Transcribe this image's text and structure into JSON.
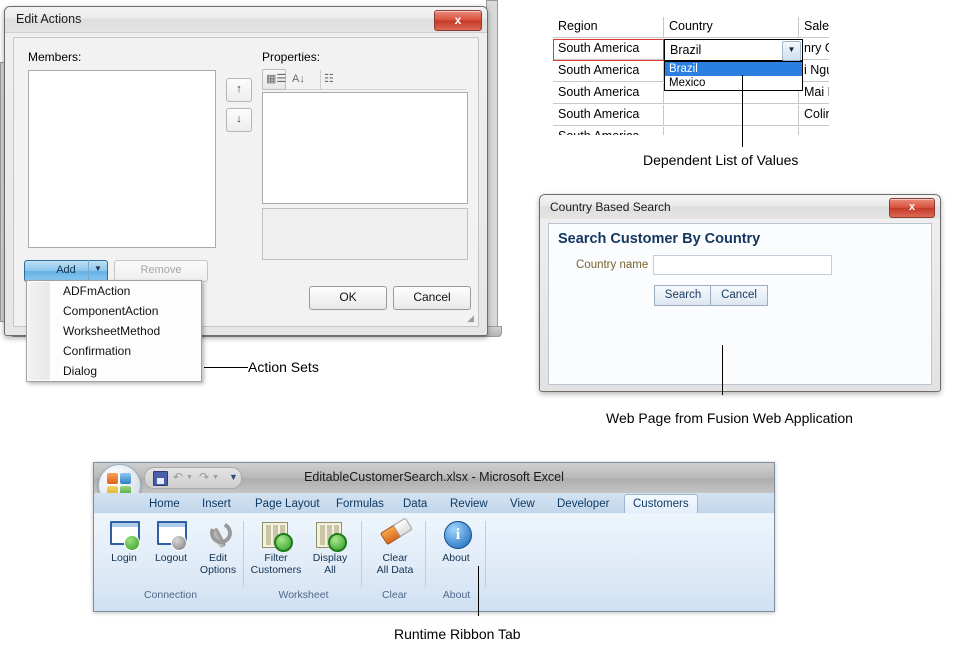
{
  "edit_actions_dialog": {
    "title": "Edit Actions",
    "close_label": "x",
    "members_label": "Members:",
    "properties_label": "Properties:",
    "move_up_label": "↑",
    "move_down_label": "↓",
    "toolbar_icons": [
      "categorized-icon",
      "alphabetical-sort-icon",
      "property-pages-icon"
    ],
    "add_button": "Add",
    "add_dropdown_arrow": "▼",
    "remove_button": "Remove",
    "ok_button": "OK",
    "cancel_button": "Cancel",
    "resize_grip": "◢"
  },
  "action_menu": {
    "items": [
      {
        "label": "ADFmAction"
      },
      {
        "label": "ComponentAction"
      },
      {
        "label": "WorksheetMethod"
      },
      {
        "label": "Confirmation"
      },
      {
        "label": "Dialog"
      }
    ]
  },
  "spreadsheet": {
    "headers": [
      "Region",
      "Country",
      "Sales R"
    ],
    "rows": [
      {
        "region": "South America",
        "country": "Brazil",
        "rep": "nry G"
      },
      {
        "region": "South America",
        "country": "",
        "rep": "i Ngu"
      },
      {
        "region": "South America",
        "country": "",
        "rep": "Mai Ngu"
      },
      {
        "region": "South America",
        "country": "",
        "rep": "Colin M"
      }
    ],
    "combo_value": "Brazil",
    "combo_arrow": "▼",
    "combo_options": [
      "Brazil",
      "Mexico"
    ],
    "combo_selected_index": 0,
    "selection_outline_color": "#e03b2f"
  },
  "country_search_dialog": {
    "title": "Country Based Search",
    "close_label": "x",
    "heading": "Search Customer By Country",
    "field_label": "Country name",
    "field_value": "",
    "field_placeholder": "",
    "search_button": "Search",
    "cancel_button": "Cancel",
    "heading_color": "#13355e",
    "label_color": "#7a6430"
  },
  "excel_window": {
    "document_title": "EditableCustomerSearch.xlsx - Microsoft Excel",
    "office_button": "office-orb-icon",
    "quick_access": [
      {
        "name": "save-icon",
        "label": "Save"
      },
      {
        "name": "undo-icon",
        "label": "Undo"
      },
      {
        "name": "redo-icon",
        "label": "Redo"
      },
      {
        "name": "customize-qat-icon",
        "label": "Customize Quick Access Toolbar"
      }
    ],
    "tabs": [
      {
        "label": "Home",
        "active": false
      },
      {
        "label": "Insert",
        "active": false
      },
      {
        "label": "Page Layout",
        "active": false
      },
      {
        "label": "Formulas",
        "active": false
      },
      {
        "label": "Data",
        "active": false
      },
      {
        "label": "Review",
        "active": false
      },
      {
        "label": "View",
        "active": false
      },
      {
        "label": "Developer",
        "active": false
      },
      {
        "label": "Customers",
        "active": true
      }
    ],
    "ribbon_groups": [
      {
        "name": "Connection",
        "buttons": [
          {
            "label_line1": "Login",
            "label_line2": "",
            "icon": "login-window-icon"
          },
          {
            "label_line1": "Logout",
            "label_line2": "",
            "icon": "logout-window-icon"
          },
          {
            "label_line1": "Edit",
            "label_line2": "Options",
            "icon": "wrench-icon"
          }
        ]
      },
      {
        "name": "Worksheet",
        "buttons": [
          {
            "label_line1": "Filter",
            "label_line2": "Customers",
            "icon": "filter-worksheet-icon"
          },
          {
            "label_line1": "Display",
            "label_line2": "All",
            "icon": "display-all-worksheet-icon"
          }
        ]
      },
      {
        "name": "Clear",
        "buttons": [
          {
            "label_line1": "Clear",
            "label_line2": "All Data",
            "icon": "eraser-icon"
          }
        ]
      },
      {
        "name": "About",
        "buttons": [
          {
            "label_line1": "About",
            "label_line2": "",
            "icon": "info-icon"
          }
        ]
      }
    ]
  },
  "callouts": [
    {
      "text": "Action Sets"
    },
    {
      "text": "Dependent List of Values"
    },
    {
      "text": "Web Page from Fusion Web Application"
    },
    {
      "text": "Runtime Ribbon Tab"
    }
  ]
}
